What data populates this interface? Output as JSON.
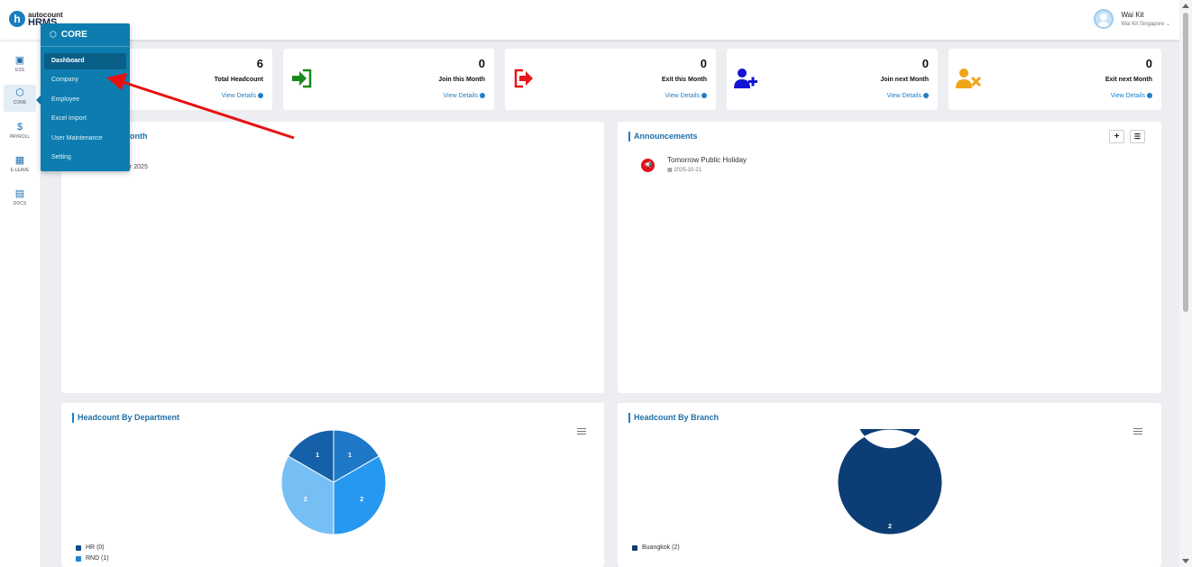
{
  "header": {
    "logo_top": "autocount",
    "logo_bottom": "HRMS",
    "user_name": "Wai Kit",
    "user_company": "Wai Kit Singapore"
  },
  "sidebar": {
    "items": [
      {
        "label": "ESS",
        "icon": "ess-icon"
      },
      {
        "label": "CORE",
        "icon": "cube-icon"
      },
      {
        "label": "PAYROLL",
        "icon": "dollar-icon"
      },
      {
        "label": "E-LEAVE",
        "icon": "calendar-icon"
      },
      {
        "label": "DOCS",
        "icon": "document-icon"
      }
    ]
  },
  "flyout": {
    "title": "CORE",
    "items": [
      "Dashboard",
      "Company",
      "Employee",
      "Excel Import",
      "User Maintenance",
      "Setting"
    ],
    "active": "Dashboard"
  },
  "stats": [
    {
      "value": "6",
      "label": "Total Headcount",
      "link": "View Details"
    },
    {
      "value": "0",
      "label": "Join this Month",
      "link": "View Details",
      "icon": "sign-in-icon",
      "color": "#1a8a1a"
    },
    {
      "value": "0",
      "label": "Exit this Month",
      "link": "View Details",
      "icon": "sign-out-icon",
      "color": "#e8161b"
    },
    {
      "value": "0",
      "label": "Join next Month",
      "link": "View Details",
      "icon": "user-plus-icon",
      "color": "#1313d6"
    },
    {
      "value": "0",
      "label": "Exit next Month",
      "link": "View Details",
      "icon": "user-times-icon",
      "color": "#f0a418"
    }
  ],
  "birthday_panel": {
    "title_partial": "onth",
    "text_partial": "r 2025"
  },
  "announcements": {
    "title": "Announcements",
    "add_label": "+",
    "items": [
      {
        "title": "Tomorrow Public Holiday",
        "date": "2025-10-21"
      }
    ]
  },
  "dept_panel": {
    "title": "Headcount By Department",
    "legend": [
      {
        "name": "HR",
        "count": "(0)",
        "color": "#0d4d8c"
      },
      {
        "name": "RND",
        "count": "(1)",
        "color": "#2383cf"
      }
    ]
  },
  "branch_panel": {
    "title": "Headcount By Branch",
    "legend": [
      {
        "name": "Buangkok",
        "count": "(2)",
        "color": "#0d3d75"
      }
    ]
  },
  "chart_data": [
    {
      "type": "pie",
      "title": "Headcount By Department",
      "slice_labels": [
        "1",
        "2",
        "2",
        "1"
      ],
      "values": [
        1,
        2,
        2,
        1
      ],
      "colors": [
        "#1f78c8",
        "#2698f0",
        "#76bff5",
        "#1560a8"
      ]
    },
    {
      "type": "pie",
      "title": "Headcount By Branch",
      "categories": [
        "Buangkok"
      ],
      "values": [
        2
      ],
      "labels": [
        "2"
      ],
      "donut": true,
      "colors": [
        "#0d3d75"
      ]
    }
  ]
}
